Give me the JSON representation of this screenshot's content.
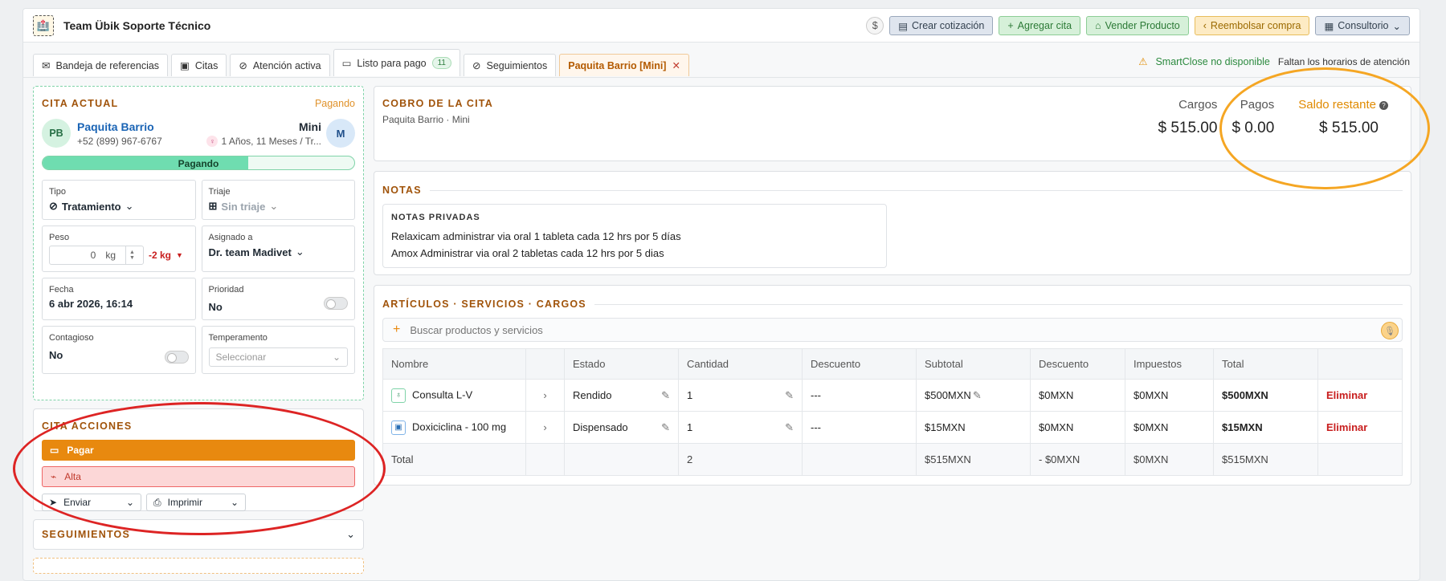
{
  "app": {
    "title": "Team Übik Soporte Técnico",
    "logo_icon": "clinic-logo-icon"
  },
  "top_actions": {
    "dollar": "$",
    "crear_cotizacion": "Crear cotización",
    "agregar_cita": "Agregar cita",
    "vender_producto": "Vender Producto",
    "reembolsar": "Reembolsar compra",
    "consultorio": "Consultorio"
  },
  "tabs": [
    {
      "label": "Bandeja de referencias",
      "icon": "mail-icon"
    },
    {
      "label": "Citas",
      "icon": "calendar-icon"
    },
    {
      "label": "Atención activa",
      "icon": "pill-icon"
    },
    {
      "label": "Listo para pago",
      "icon": "payment-icon",
      "badge": "11"
    },
    {
      "label": "Seguimientos",
      "icon": "link-icon"
    },
    {
      "label": "Paquita Barrio [Mini]",
      "active": true
    }
  ],
  "smartclose": {
    "label": "SmartClose no disponible",
    "note": "Faltan los horarios de atención"
  },
  "cita_actual": {
    "title": "CITA ACTUAL",
    "status": "Pagando",
    "owner": {
      "initials": "PB",
      "name": "Paquita Barrio",
      "phone": "+52 (899) 967-6767"
    },
    "pet": {
      "name": "Mini",
      "initial": "M",
      "age": "1 Años, 11 Meses / Tr..."
    },
    "progress": {
      "label": "Pagando",
      "fraction": 0.66
    },
    "tipo": {
      "label": "Tipo",
      "value": "Tratamiento"
    },
    "triaje": {
      "label": "Triaje",
      "value": "Sin triaje"
    },
    "peso": {
      "label": "Peso",
      "value": "0",
      "unit": "kg",
      "delta": "-2 kg"
    },
    "asignado": {
      "label": "Asignado a",
      "value": "Dr. team Madivet"
    },
    "fecha": {
      "label": "Fecha",
      "value": "6 abr 2026, 16:14"
    },
    "prioridad": {
      "label": "Prioridad",
      "value": "No"
    },
    "contagioso": {
      "label": "Contagioso",
      "value": "No"
    },
    "temperamento": {
      "label": "Temperamento",
      "placeholder": "Seleccionar"
    }
  },
  "acciones": {
    "title": "CITA ACCIONES",
    "pagar": "Pagar",
    "alta": "Alta",
    "enviar": "Enviar",
    "imprimir": "Imprimir"
  },
  "seguimientos": {
    "title": "SEGUIMIENTOS"
  },
  "cobro": {
    "title": "COBRO DE LA CITA",
    "subtitle": "Paquita Barrio · Mini",
    "cargos_label": "Cargos",
    "cargos_value": "$ 515.00",
    "pagos_label": "Pagos",
    "pagos_value": "$ 0.00",
    "saldo_label": "Saldo restante",
    "saldo_value": "$ 515.00"
  },
  "notas": {
    "title": "NOTAS",
    "private_title": "NOTAS PRIVADAS",
    "lines": [
      "Relaxicam administrar via oral 1 tableta cada 12 hrs por 5 días",
      "Amox Administrar via oral 2 tabletas cada 12 hrs por  5 dias"
    ]
  },
  "articulos": {
    "title": "ARTÍCULOS · SERVICIOS · CARGOS",
    "search_placeholder": "Buscar productos y servicios",
    "headers": [
      "Nombre",
      "",
      "Estado",
      "Cantidad",
      "Descuento",
      "Subtotal",
      "Descuento",
      "Impuestos",
      "Total",
      ""
    ],
    "rows": [
      {
        "nombre": "Consulta L-V",
        "estado": "Rendido",
        "cantidad": "1",
        "descuento": "---",
        "subtotal": "$500MXN",
        "descuento2": "$0MXN",
        "impuestos": "$0MXN",
        "total": "$500MXN",
        "accion": "Eliminar"
      },
      {
        "nombre": "Doxiciclina - 100 mg",
        "estado": "Dispensado",
        "cantidad": "1",
        "descuento": "---",
        "subtotal": "$15MXN",
        "descuento2": "$0MXN",
        "impuestos": "$0MXN",
        "total": "$15MXN",
        "accion": "Eliminar"
      }
    ],
    "total_row": {
      "label": "Total",
      "cantidad": "2",
      "subtotal": "$515MXN",
      "descuento2": "- $0MXN",
      "impuestos": "$0MXN",
      "total": "$515MXN"
    }
  },
  "colors": {
    "accent": "#e8890f",
    "success": "#2c8a3f",
    "danger": "#c81e1e",
    "annotation_orange": "#f5a623",
    "annotation_red": "#dd2424"
  }
}
